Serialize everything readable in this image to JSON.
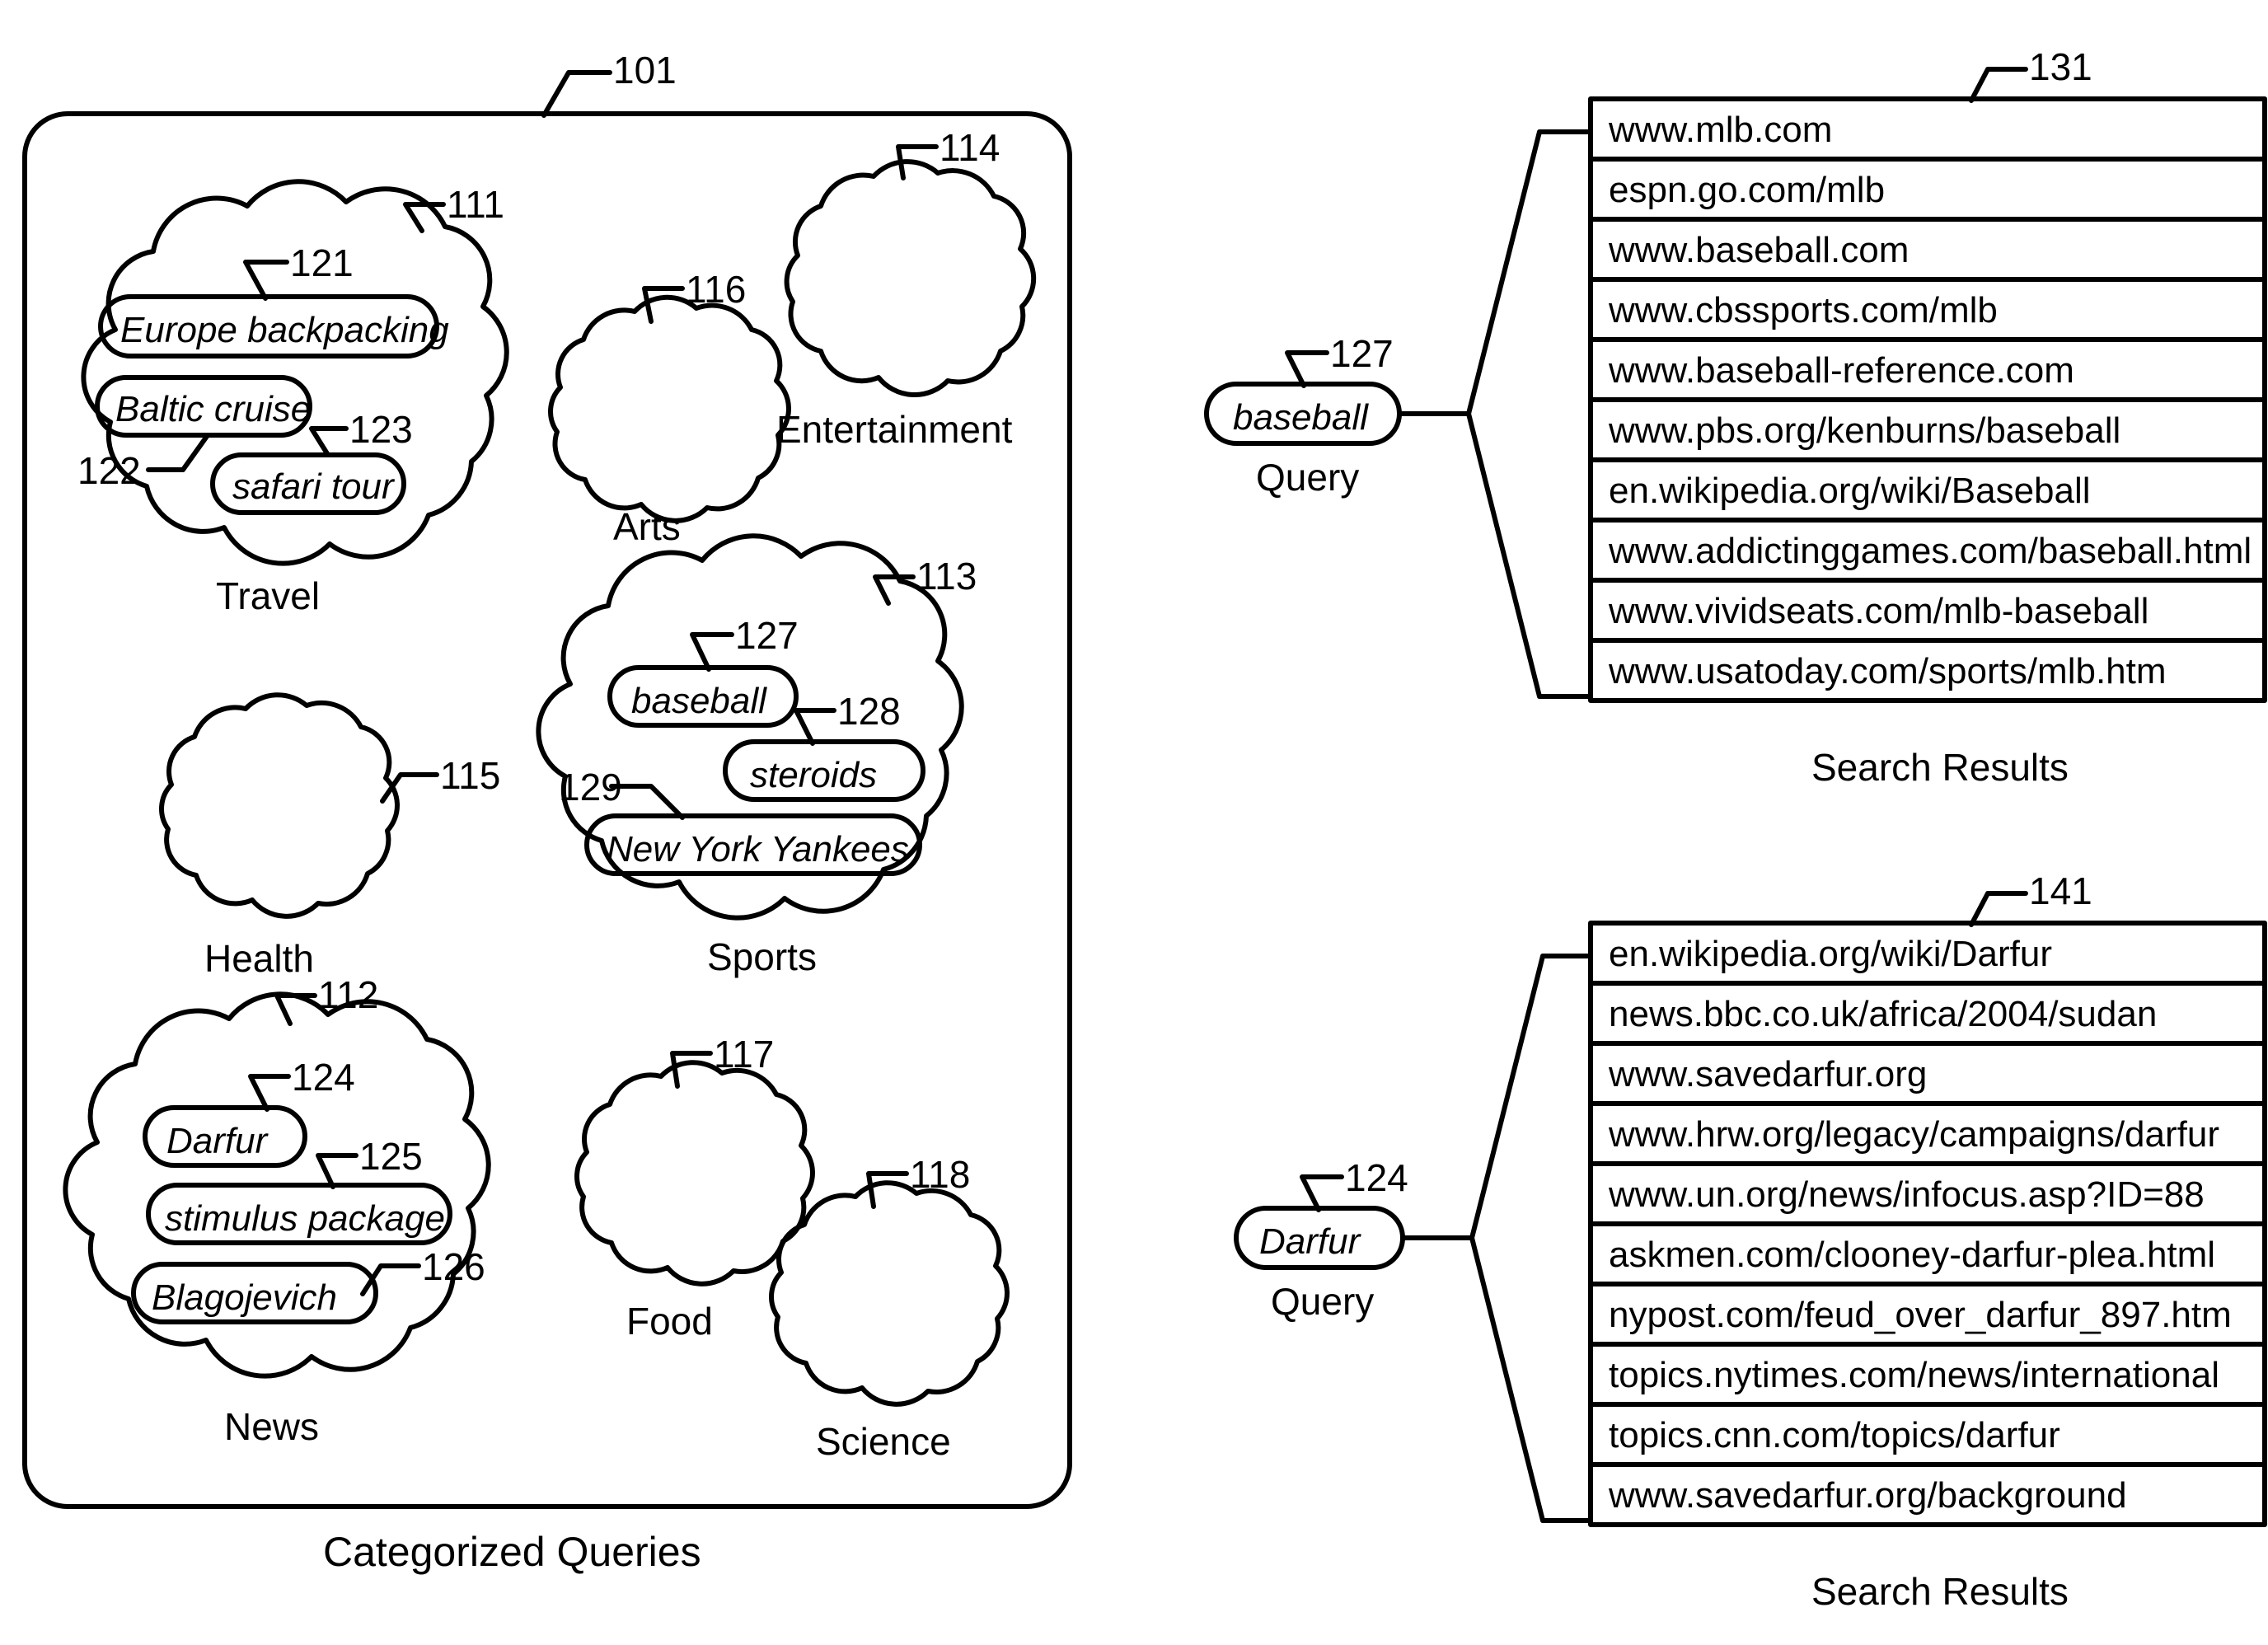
{
  "figure": {
    "panel_ref": "101",
    "panel_caption": "Categorized Queries"
  },
  "categories": [
    {
      "ref": "111",
      "name": "Travel",
      "queries": [
        {
          "ref": "121",
          "text": "Europe backpacking"
        },
        {
          "ref": "122",
          "text": "Baltic cruise"
        },
        {
          "ref": "123",
          "text": "safari tour"
        }
      ]
    },
    {
      "ref": "112",
      "name": "News",
      "queries": [
        {
          "ref": "124",
          "text": "Darfur"
        },
        {
          "ref": "125",
          "text": "stimulus package"
        },
        {
          "ref": "126",
          "text": "Blagojevich"
        }
      ]
    },
    {
      "ref": "113",
      "name": "Sports",
      "queries": [
        {
          "ref": "127",
          "text": "baseball"
        },
        {
          "ref": "128",
          "text": "steroids"
        },
        {
          "ref": "129",
          "text": "New York Yankees"
        }
      ]
    },
    {
      "ref": "114",
      "name": "Entertainment",
      "queries": []
    },
    {
      "ref": "115",
      "name": "Health",
      "queries": []
    },
    {
      "ref": "116",
      "name": "Arts",
      "queries": []
    },
    {
      "ref": "117",
      "name": "Food",
      "queries": []
    },
    {
      "ref": "118",
      "name": "Science",
      "queries": []
    }
  ],
  "search_blocks": [
    {
      "query": {
        "ref": "127",
        "text": "baseball",
        "caption": "Query"
      },
      "results_ref": "131",
      "results_caption": "Search Results",
      "results": [
        "www.mlb.com",
        "espn.go.com/mlb",
        "www.baseball.com",
        "www.cbssports.com/mlb",
        "www.baseball-reference.com",
        "www.pbs.org/kenburns/baseball",
        "en.wikipedia.org/wiki/Baseball",
        "www.addictinggames.com/baseball.html",
        "www.vividseats.com/mlb-baseball",
        "www.usatoday.com/sports/mlb.htm"
      ]
    },
    {
      "query": {
        "ref": "124",
        "text": "Darfur",
        "caption": "Query"
      },
      "results_ref": "141",
      "results_caption": "Search Results",
      "results": [
        "en.wikipedia.org/wiki/Darfur",
        "news.bbc.co.uk/africa/2004/sudan",
        "www.savedarfur.org",
        "www.hrw.org/legacy/campaigns/darfur",
        "www.un.org/news/infocus.asp?ID=88",
        "askmen.com/clooney-darfur-plea.html",
        "nypost.com/feud_over_darfur_897.htm",
        "topics.nytimes.com/news/international",
        "topics.cnn.com/topics/darfur",
        "www.savedarfur.org/background"
      ]
    }
  ]
}
